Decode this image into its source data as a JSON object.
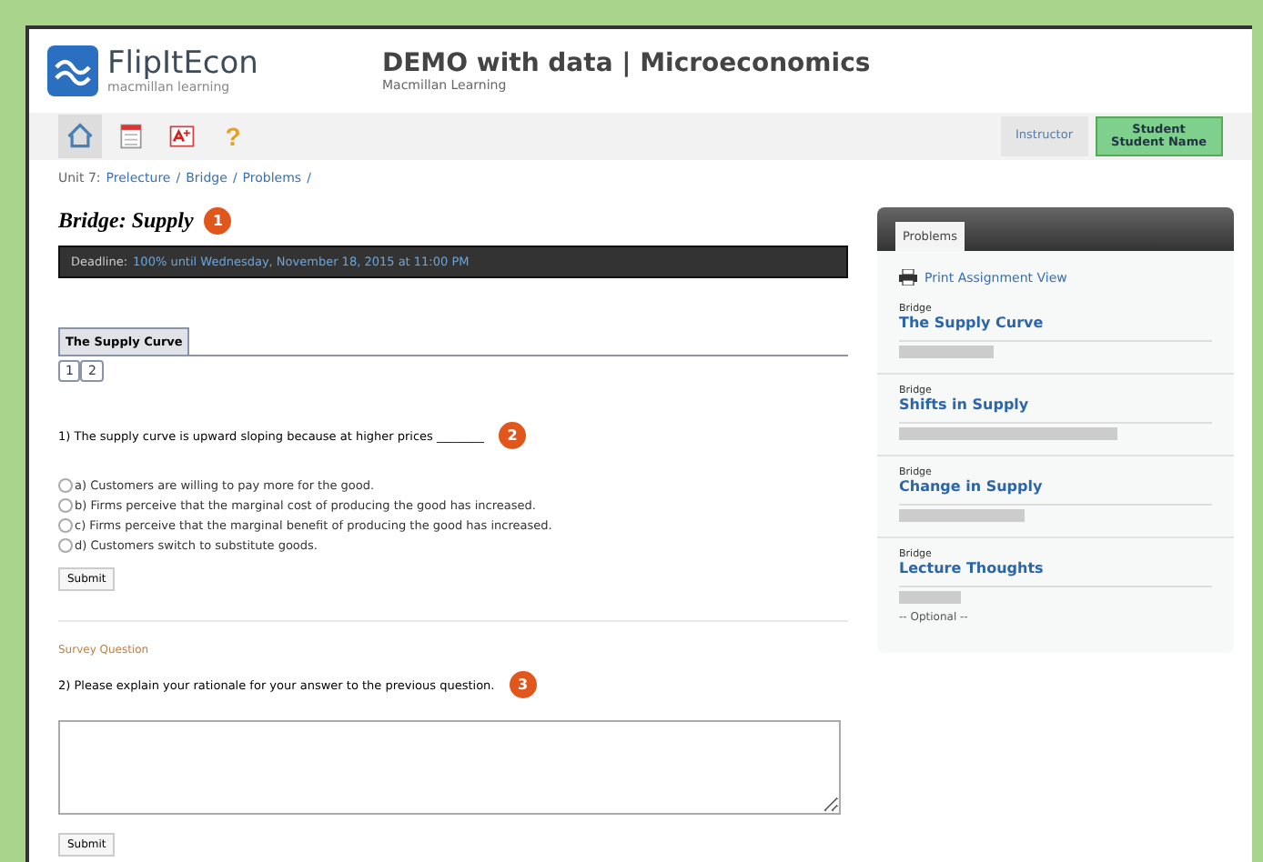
{
  "logo": {
    "name": "FlipItEcon",
    "tagline": "macmillan learning"
  },
  "course": {
    "title": "DEMO with data | Microeconomics",
    "publisher": "Macmillan Learning"
  },
  "toolbar": [
    {
      "kind": "home",
      "selected": true
    },
    {
      "kind": "calendar",
      "selected": false
    },
    {
      "kind": "grades",
      "selected": false
    },
    {
      "kind": "help",
      "label": "?",
      "selected": false
    }
  ],
  "roles": [
    {
      "lines": [
        "Instructor"
      ],
      "selected": false
    },
    {
      "lines": [
        "Student",
        "Student Name"
      ],
      "selected": true
    }
  ],
  "breadcrumb": {
    "prefix": "Unit 7:",
    "separator": "/",
    "links": [
      "Prelecture",
      "Bridge",
      "Problems"
    ]
  },
  "page_title": {
    "text": "Bridge: Supply",
    "badge": "1"
  },
  "deadline": {
    "label": "Deadline:",
    "value": "100% until Wednesday, November 18, 2015 at 11:00 PM"
  },
  "section_tab": "The Supply Curve",
  "pages": [
    {
      "label": "1",
      "selected": false
    },
    {
      "label": "2",
      "selected": false
    }
  ],
  "question1": {
    "text": "1) The supply curve is upward sloping because at higher prices ________",
    "badge": "2",
    "options": [
      {
        "text": "a) Customers are willing to pay more for the good.",
        "checked": false
      },
      {
        "text": "b) Firms perceive that the marginal cost of producing the good has increased.",
        "checked": false
      },
      {
        "text": "c) Firms perceive that the marginal benefit of producing the good has increased.",
        "checked": false
      },
      {
        "text": "d) Customers switch to substitute goods.",
        "checked": false
      }
    ],
    "submit": "Submit"
  },
  "question2": {
    "label": "Survey Question",
    "text": "2) Please explain your rationale for your answer to the previous question.",
    "badge": "3",
    "submit": "Submit"
  },
  "sidebar": {
    "tab": "Problems",
    "print_link": "Print Assignment View",
    "items": [
      {
        "type": "Bridge",
        "title": "The Supply Curve",
        "level": 0.3
      },
      {
        "type": "Bridge",
        "title": "Shifts in Supply",
        "level": 0.7
      },
      {
        "type": "Bridge",
        "title": "Change in Supply",
        "level": 0.4
      },
      {
        "type": "Bridge",
        "title": "Lecture Thoughts",
        "level": 0.2,
        "note": "-- Optional --"
      }
    ]
  }
}
